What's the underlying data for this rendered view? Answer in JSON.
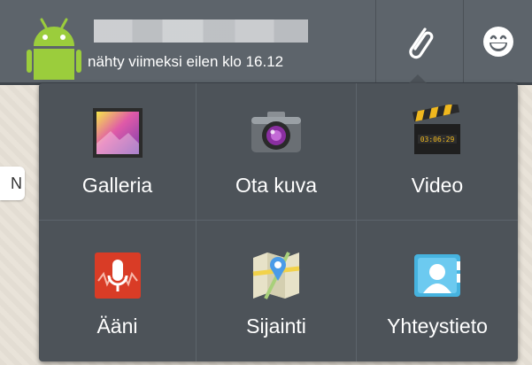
{
  "header": {
    "last_seen": "nähty viimeksi eilen klo 16.12"
  },
  "attach_menu": {
    "items": [
      {
        "label": "Galleria",
        "icon": "gallery-icon"
      },
      {
        "label": "Ota kuva",
        "icon": "camera-icon"
      },
      {
        "label": "Video",
        "icon": "video-clapper-icon"
      },
      {
        "label": "Ääni",
        "icon": "microphone-icon"
      },
      {
        "label": "Sijainti",
        "icon": "map-location-icon"
      },
      {
        "label": "Yhteystieto",
        "icon": "contact-card-icon"
      }
    ]
  },
  "colors": {
    "topbar": "#5d646b",
    "menu_bg": "#4d5359",
    "android_green": "#9bcd3c"
  }
}
